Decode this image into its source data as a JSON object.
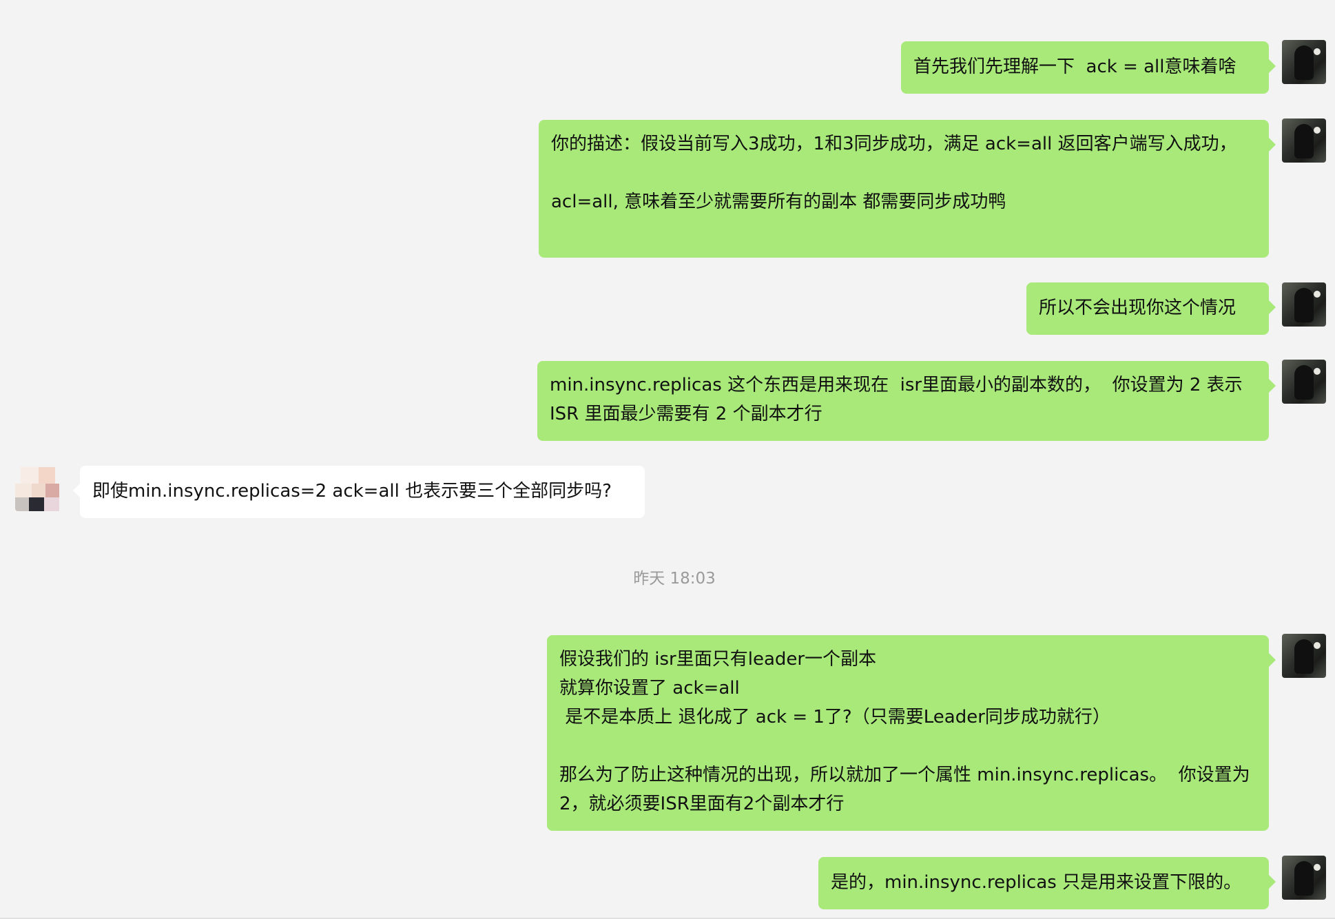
{
  "colors": {
    "background": "#f3f3f3",
    "self_bubble": "#a8e97a",
    "other_bubble": "#ffffff",
    "timestamp_text": "#9a9a9a"
  },
  "messages": [
    {
      "sender": "self",
      "text": "首先我们先理解一下  ack = all意味着啥"
    },
    {
      "sender": "self",
      "text": "你的描述：假设当前写入3成功，1和3同步成功，满足 ack=all 返回客户端写入成功，\n\nacl=all, 意味着至少就需要所有的副本 都需要同步成功鸭"
    },
    {
      "sender": "self",
      "text": "所以不会出现你这个情况"
    },
    {
      "sender": "self",
      "text": "min.insync.replicas 这个东西是用来现在  isr里面最小的副本数的，  你设置为 2 表示 ISR 里面最少需要有 2 个副本才行"
    },
    {
      "sender": "other",
      "text": "即使min.insync.replicas=2 ack=all 也表示要三个全部同步吗?"
    },
    {
      "sender": "self",
      "text": "假设我们的 isr里面只有leader一个副本\n就算你设置了 ack=all\n 是不是本质上 退化成了 ack = 1了?（只需要Leader同步成功就行）\n\n那么为了防止这种情况的出现，所以就加了一个属性 min.insync.replicas。  你设置为 2，就必须要ISR里面有2个副本才行"
    },
    {
      "sender": "self",
      "text": "是的，min.insync.replicas 只是用来设置下限的。"
    }
  ],
  "timestamp": "昨天 18:03"
}
